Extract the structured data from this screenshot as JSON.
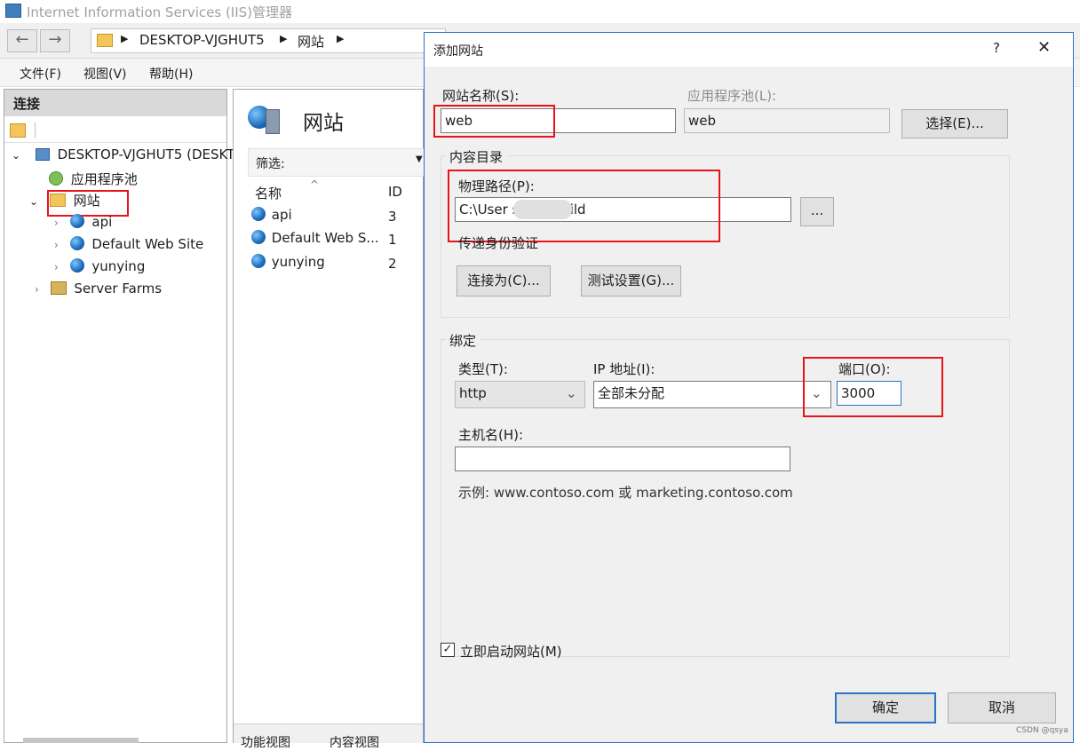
{
  "window": {
    "title": "Internet Information Services (IIS)管理器",
    "breadcrumb": [
      "DESKTOP-VJGHUT5",
      "网站"
    ],
    "menu": [
      "文件(F)",
      "视图(V)",
      "帮助(H)"
    ]
  },
  "connections": {
    "header": "连接",
    "tree": {
      "server": "DESKTOP-VJGHUT5 (DESKT",
      "app_pools": "应用程序池",
      "sites": "网站",
      "site_items": [
        "api",
        "Default Web Site",
        "yunying"
      ],
      "server_farms": "Server Farms"
    }
  },
  "center": {
    "title": "网站",
    "filter_label": "筛选:",
    "columns": {
      "name": "名称",
      "id": "ID"
    },
    "rows": [
      {
        "name": "api",
        "id": "3"
      },
      {
        "name": "Default Web S...",
        "id": "1"
      },
      {
        "name": "yunying",
        "id": "2"
      }
    ],
    "bottom_tabs": [
      "功能视图",
      "内容视图"
    ]
  },
  "dialog": {
    "title": "添加网站",
    "help": "?",
    "close": "✕",
    "site_name_label": "网站名称(S):",
    "site_name_value": "web",
    "app_pool_label": "应用程序池(L):",
    "app_pool_value": "web",
    "select_button": "选择(E)...",
    "content_dir_label": "内容目录",
    "physical_path_label": "物理路径(P):",
    "physical_path_value": "C:\\User        sktop\\build",
    "browse_button": "...",
    "pass_auth_label": "传递身份验证",
    "connect_as_button": "连接为(C)...",
    "test_settings_button": "测试设置(G)...",
    "binding_label": "绑定",
    "type_label": "类型(T):",
    "type_value": "http",
    "ip_label": "IP 地址(I):",
    "ip_value": "全部未分配",
    "port_label": "端口(O):",
    "port_value": "3000",
    "host_label": "主机名(H):",
    "host_value": "",
    "example_text": "示例: www.contoso.com 或 marketing.contoso.com",
    "start_immediately_label": "立即启动网站(M)",
    "start_immediately_checked": true,
    "ok_button": "确定",
    "cancel_button": "取消"
  },
  "watermark": "CSDN @qsya",
  "colors": {
    "highlight_box": "#e8141c",
    "dialog_border": "#2b73c4"
  }
}
